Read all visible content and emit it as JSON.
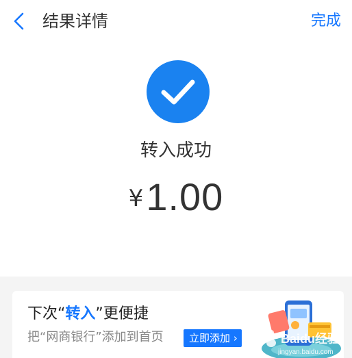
{
  "nav": {
    "title": "结果详情",
    "done_label": "完成"
  },
  "result": {
    "status": "转入成功",
    "currency": "¥",
    "amount": "1.00"
  },
  "promo": {
    "title_pre": "下次“",
    "title_highlight": "转入",
    "title_post": "”更便捷",
    "subtitle": "把“网商银行”添加到首页",
    "button_label": "立即添加 ›"
  },
  "watermark": {
    "text": "Baidu经验",
    "url": "jingyan.baidu.com"
  },
  "colors": {
    "accent": "#1677ff",
    "check_circle": "#1a82f0",
    "page_bg": "#f4f4f4"
  }
}
